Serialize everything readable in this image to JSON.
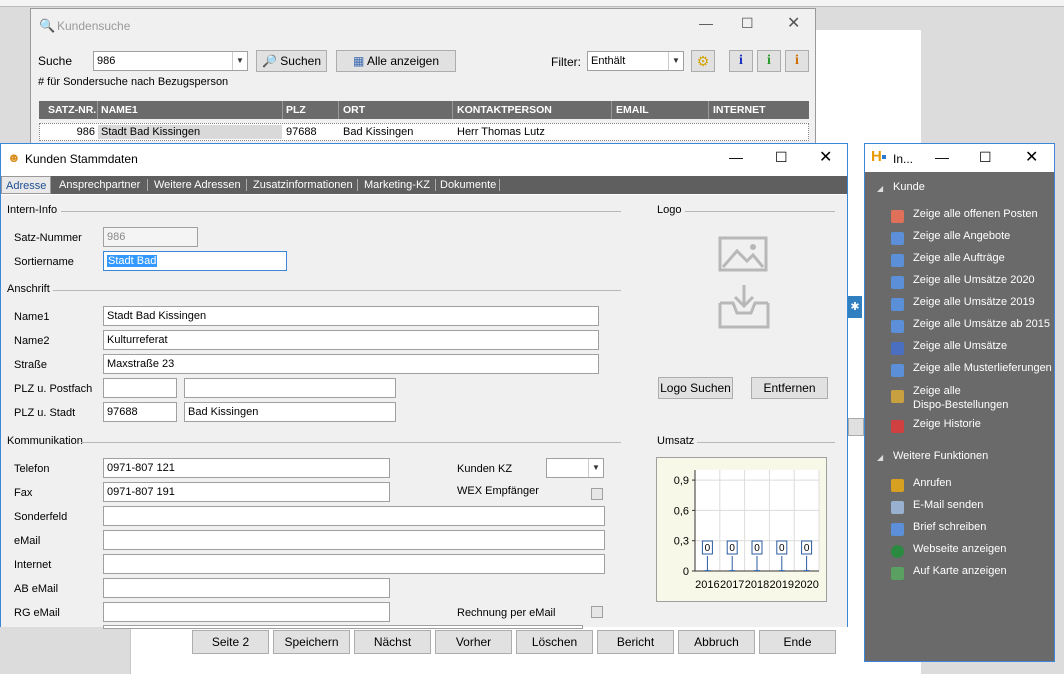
{
  "kundensuche": {
    "title": "Kundensuche",
    "suche_label": "Suche",
    "suche_value": "986",
    "suchen_button": "Suchen",
    "alle_anzeigen_button": "Alle anzeigen",
    "filter_label": "Filter:",
    "filter_value": "Enthält",
    "hint": "# für Sondersuche nach Bezugsperson",
    "columns": [
      "SATZ-NR.",
      "NAME1",
      "PLZ",
      "ORT",
      "KONTAKTPERSON",
      "EMAIL",
      "INTERNET"
    ],
    "row": {
      "satz_nr": "986",
      "name1": "Stadt Bad Kissingen",
      "plz": "97688",
      "ort": "Bad Kissingen",
      "kontakt": "Herr Thomas Lutz",
      "email": "",
      "internet": ""
    }
  },
  "stammdaten": {
    "title": "Kunden Stammdaten",
    "tabs": [
      "Adresse",
      "Ansprechpartner",
      "Weitere Adressen",
      "Zusatzinformationen",
      "Marketing-KZ",
      "Dokumente"
    ],
    "sections": {
      "intern": "Intern-Info",
      "anschrift": "Anschrift",
      "kommunikation": "Kommunikation",
      "logo": "Logo",
      "umsatz": "Umsatz"
    },
    "fields": {
      "satz_nummer": {
        "label": "Satz-Nummer",
        "value": "986"
      },
      "sortiername": {
        "label": "Sortiername",
        "value": "Stadt Bad"
      },
      "name1": {
        "label": "Name1",
        "value": "Stadt Bad Kissingen"
      },
      "name2": {
        "label": "Name2",
        "value": "Kulturreferat"
      },
      "strasse": {
        "label": "Straße",
        "value": "Maxstraße 23"
      },
      "plz_postfach": {
        "label": "PLZ u. Postfach",
        "value": "",
        "value2": ""
      },
      "plz_stadt": {
        "label": "PLZ u. Stadt",
        "value": "97688",
        "value2": "Bad Kissingen"
      },
      "telefon": {
        "label": "Telefon",
        "value": "0971-807 121"
      },
      "fax": {
        "label": "Fax",
        "value": "0971-807 191"
      },
      "sonderfeld": {
        "label": "Sonderfeld",
        "value": ""
      },
      "email": {
        "label": "eMail",
        "value": ""
      },
      "internet": {
        "label": "Internet",
        "value": ""
      },
      "ab_email": {
        "label": "AB eMail",
        "value": ""
      },
      "rg_email": {
        "label": "RG eMail",
        "value": ""
      },
      "kunden_kz": {
        "label": "Kunden KZ",
        "value": ""
      },
      "wex": {
        "label": "WEX Empfänger"
      },
      "rechnung_email": {
        "label": "Rechnung per eMail"
      }
    },
    "logo_suchen": "Logo Suchen",
    "entfernen": "Entfernen",
    "buttons": [
      "Seite 2",
      "Speichern",
      "Nächst",
      "Vorher",
      "Löschen",
      "Bericht",
      "Abbruch",
      "Ende"
    ]
  },
  "chart_data": {
    "type": "bar",
    "categories": [
      "2016",
      "2017",
      "2018",
      "2019",
      "2020"
    ],
    "values": [
      0,
      0,
      0,
      0,
      0
    ],
    "data_labels": [
      "0",
      "0",
      "0",
      "0",
      "0"
    ],
    "yticks": [
      "0",
      "0,3",
      "0,6",
      "0,9"
    ],
    "ylim": [
      0,
      1
    ],
    "grid": true
  },
  "info_panel": {
    "title": "In...",
    "sections": [
      {
        "name": "Kunde",
        "items": [
          "Zeige alle offenen Posten",
          "Zeige alle Angebote",
          "Zeige alle Aufträge",
          "Zeige alle Umsätze 2020",
          "Zeige alle Umsätze 2019",
          "Zeige alle Umsätze ab 2015",
          "Zeige alle Umsätze",
          "Zeige alle Musterlieferungen",
          "Zeige alle Dispo-Bestellungen",
          "Zeige Historie"
        ]
      },
      {
        "name": "Weitere Funktionen",
        "items": [
          "Anrufen",
          "E-Mail senden",
          "Brief schreiben",
          "Webseite anzeigen",
          "Auf Karte anzeigen"
        ]
      }
    ],
    "dispo_line1": "Zeige alle",
    "dispo_line2": "Dispo-Bestellungen"
  },
  "colors": {
    "accent": "#3b86d8",
    "grid_header": "#6b6b6b",
    "panel_bg": "#6a6a6a",
    "tabbar": "#5f5f5f",
    "selection": "#3399ff"
  }
}
